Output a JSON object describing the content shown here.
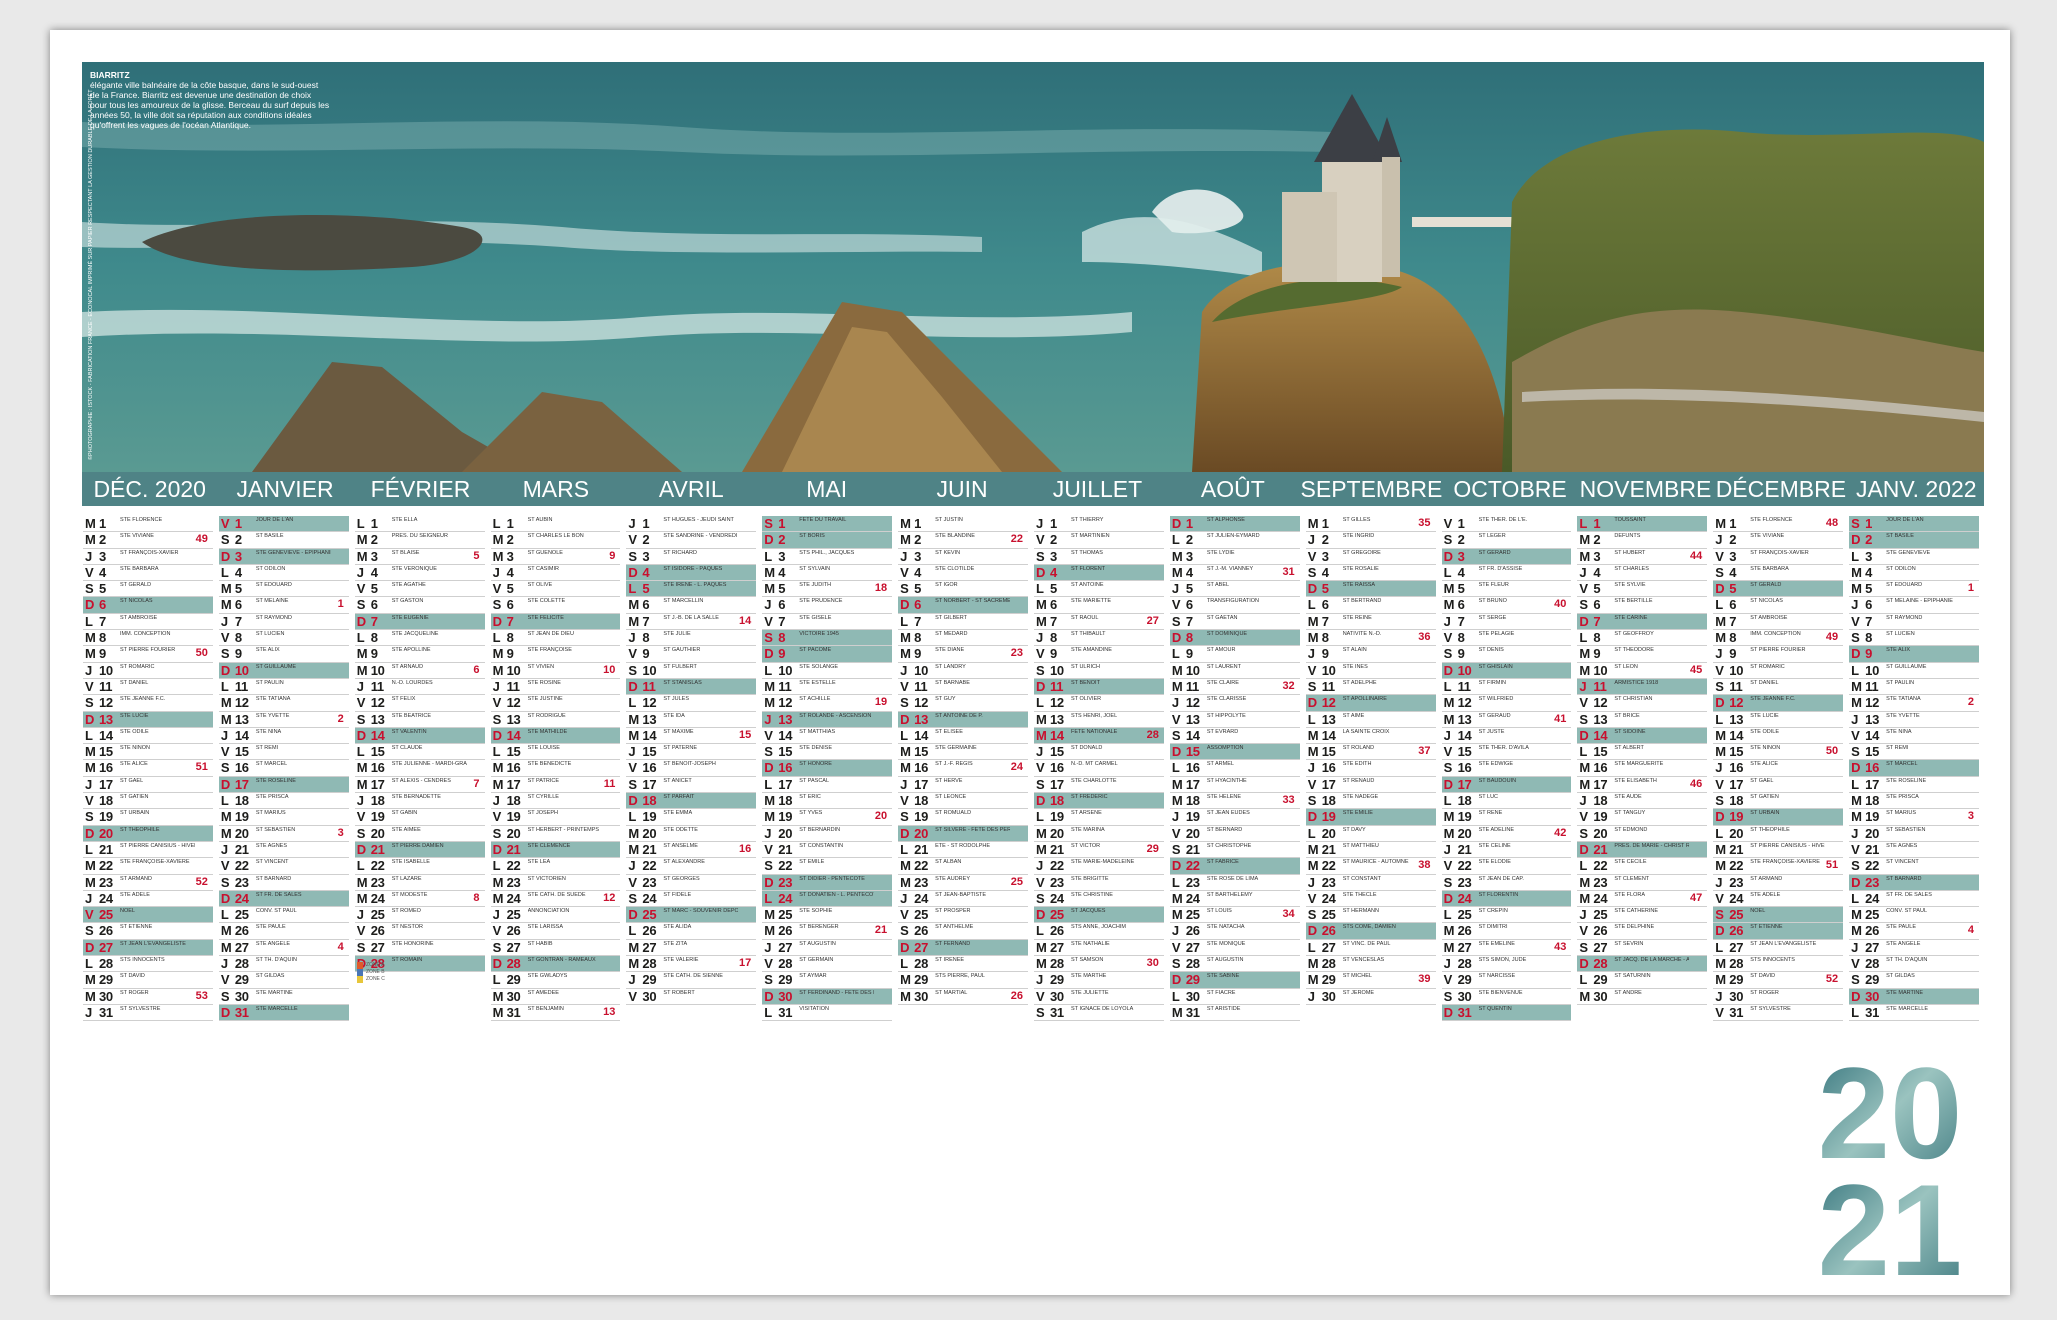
{
  "caption": {
    "title": "BIARRITZ",
    "text": "élégante ville balnéaire de la côte basque, dans le sud-ouest de la France. Biarritz est devenue une destination de choix pour tous les amoureux de la glisse. Berceau du surf depuis les années 50, la ville doit sa réputation aux conditions idéales qu'offrent les vagues de l'océan Atlantique."
  },
  "credit": "©PHOTOGRAPHIE : ISTOCK - FABRICATION FRANCE - ECONOCAL IMPRIMÉ SUR PAPIER RESPECTANT LA GESTION DURABLE DE LA FORÊT",
  "year": {
    "top": "20",
    "bottom": "21"
  },
  "colors": {
    "band": "#4f8386",
    "highlight": "#8fb9b4",
    "sunday": "#c8102e"
  },
  "months": [
    {
      "name": "DÉC. 2020",
      "start": 1,
      "days": 31
    },
    {
      "name": "JANVIER",
      "start": 4,
      "days": 31
    },
    {
      "name": "FÉVRIER",
      "start": 0,
      "days": 28
    },
    {
      "name": "MARS",
      "start": 0,
      "days": 31
    },
    {
      "name": "AVRIL",
      "start": 3,
      "days": 30
    },
    {
      "name": "MAI",
      "start": 5,
      "days": 31
    },
    {
      "name": "JUIN",
      "start": 1,
      "days": 30
    },
    {
      "name": "JUILLET",
      "start": 3,
      "days": 31
    },
    {
      "name": "AOÛT",
      "start": 6,
      "days": 31
    },
    {
      "name": "SEPTEMBRE",
      "start": 2,
      "days": 30
    },
    {
      "name": "OCTOBRE",
      "start": 4,
      "days": 31
    },
    {
      "name": "NOVEMBRE",
      "start": 0,
      "days": 30
    },
    {
      "name": "DÉCEMBRE",
      "start": 2,
      "days": 31
    },
    {
      "name": "JANV. 2022",
      "start": 5,
      "days": 31
    }
  ],
  "weekday_letters": [
    "L",
    "M",
    "M",
    "J",
    "V",
    "S",
    "D"
  ],
  "holidays": {
    "DÉC. 2020": [
      25
    ],
    "JANVIER": [
      1
    ],
    "AVRIL": [
      5
    ],
    "MAI": [
      1,
      8,
      13,
      24
    ],
    "JUILLET": [
      14
    ],
    "AOÛT": [
      15
    ],
    "NOVEMBRE": [
      1,
      11
    ],
    "DÉCEMBRE": [
      25
    ],
    "JANV. 2022": [
      1
    ]
  },
  "week_numbers": {
    "DÉC. 2020": [
      [
        2,
        49
      ],
      [
        9,
        50
      ],
      [
        16,
        51
      ],
      [
        23,
        52
      ],
      [
        30,
        53
      ]
    ],
    "JANVIER": [
      [
        6,
        1
      ],
      [
        13,
        2
      ],
      [
        20,
        3
      ],
      [
        27,
        4
      ]
    ],
    "FÉVRIER": [
      [
        3,
        5
      ],
      [
        10,
        6
      ],
      [
        17,
        7
      ],
      [
        24,
        8
      ]
    ],
    "MARS": [
      [
        3,
        9
      ],
      [
        10,
        10
      ],
      [
        17,
        11
      ],
      [
        24,
        12
      ],
      [
        31,
        13
      ]
    ],
    "AVRIL": [
      [
        7,
        14
      ],
      [
        14,
        15
      ],
      [
        21,
        16
      ],
      [
        28,
        17
      ]
    ],
    "MAI": [
      [
        5,
        18
      ],
      [
        12,
        19
      ],
      [
        19,
        20
      ],
      [
        26,
        21
      ]
    ],
    "JUIN": [
      [
        2,
        22
      ],
      [
        9,
        23
      ],
      [
        16,
        24
      ],
      [
        23,
        25
      ],
      [
        30,
        26
      ]
    ],
    "JUILLET": [
      [
        7,
        27
      ],
      [
        14,
        28
      ],
      [
        21,
        29
      ],
      [
        28,
        30
      ]
    ],
    "AOÛT": [
      [
        4,
        31
      ],
      [
        11,
        32
      ],
      [
        18,
        33
      ],
      [
        25,
        34
      ]
    ],
    "SEPTEMBRE": [
      [
        1,
        35
      ],
      [
        8,
        36
      ],
      [
        15,
        37
      ],
      [
        22,
        38
      ],
      [
        29,
        39
      ]
    ],
    "OCTOBRE": [
      [
        6,
        40
      ],
      [
        13,
        41
      ],
      [
        20,
        42
      ],
      [
        27,
        43
      ]
    ],
    "NOVEMBRE": [
      [
        3,
        44
      ],
      [
        10,
        45
      ],
      [
        17,
        46
      ],
      [
        24,
        47
      ]
    ],
    "DÉCEMBRE": [
      [
        1,
        48
      ],
      [
        8,
        49
      ],
      [
        15,
        50
      ],
      [
        22,
        51
      ],
      [
        29,
        52
      ]
    ],
    "JANV. 2022": [
      [
        5,
        1
      ],
      [
        12,
        2
      ],
      [
        19,
        3
      ],
      [
        26,
        4
      ]
    ]
  },
  "saints": {
    "DÉC. 2020": [
      "STE FLORENCE",
      "STE VIVIANE",
      "ST FRANÇOIS-XAVIER",
      "STE BARBARA",
      "ST GÉRALD",
      "ST NICOLAS",
      "ST AMBROISE",
      "IMM. CONCEPTION",
      "ST PIERRE FOURIER",
      "ST ROMARIC",
      "ST DANIEL",
      "STE JEANNE F.C.",
      "STE LUCIE",
      "STE ODILE",
      "STE NINON",
      "STE ALICE",
      "ST GAËL",
      "ST GATIEN",
      "ST URBAIN",
      "ST THÉOPHILE",
      "ST PIERRE CANISIUS - HIVER",
      "STE FRANÇOISE-XAVIÈRE",
      "ST ARMAND",
      "STE ADÈLE",
      "NOËL",
      "ST ÉTIENNE",
      "ST JEAN L'ÉVANGÉLISTE",
      "STS INNOCENTS",
      "ST DAVID",
      "ST ROGER",
      "ST SYLVESTRE"
    ],
    "JANVIER": [
      "JOUR DE L'AN",
      "ST BASILE",
      "STE GENEVIÈVE - ÉPIPHANIE",
      "ST ODILON",
      "ST ÉDOUARD",
      "ST MÉLAINE",
      "ST RAYMOND",
      "ST LUCIEN",
      "STE ALIX",
      "ST GUILLAUME",
      "ST PAULIN",
      "STE TATIANA",
      "STE YVETTE",
      "STE NINA",
      "ST RÉMI",
      "ST MARCEL",
      "STE ROSELINE",
      "STE PRISCA",
      "ST MARIUS",
      "ST SÉBASTIEN",
      "STE AGNÈS",
      "ST VINCENT",
      "ST BARNARD",
      "ST FR. DE SALES",
      "CONV. ST PAUL",
      "STE PAULE",
      "STE ANGÈLE",
      "ST TH. D'AQUIN",
      "ST GILDAS",
      "STE MARTINE",
      "STE MARCELLE"
    ],
    "FÉVRIER": [
      "STE ELLA",
      "PRÉS. DU SEIGNEUR",
      "ST BLAISE",
      "STE VÉRONIQUE",
      "STE AGATHE",
      "ST GASTON",
      "STE EUGÉNIE",
      "STE JACQUELINE",
      "STE APOLLINE",
      "ST ARNAUD",
      "N.-D. LOURDES",
      "ST FÉLIX",
      "STE BÉATRICE",
      "ST VALENTIN",
      "ST CLAUDE",
      "STE JULIENNE - MARDI-GRAS",
      "ST ALEXIS - CENDRES",
      "STE BERNADETTE",
      "ST GABIN",
      "STE AIMÉE",
      "ST PIERRE DAMIEN",
      "STE ISABELLE",
      "ST LAZARE",
      "ST MODESTE",
      "ST ROMÉO",
      "ST NESTOR",
      "STE HONORINE",
      "ST ROMAIN"
    ],
    "MARS": [
      "ST AUBIN",
      "ST CHARLES LE BON",
      "ST GUÉNOLÉ",
      "ST CASIMIR",
      "ST OLIVE",
      "STE COLETTE",
      "STE FÉLICITÉ",
      "ST JEAN DE DIEU",
      "STE FRANÇOISE",
      "ST VIVIEN",
      "STE ROSINE",
      "STE JUSTINE",
      "ST RODRIGUE",
      "STE MATHILDE",
      "STE LOUISE",
      "STE BÉNÉDICTE",
      "ST PATRICE",
      "ST CYRILLE",
      "ST JOSEPH",
      "ST HERBERT - PRINTEMPS",
      "STE CLÉMENCE",
      "STE LÉA",
      "ST VICTORIEN",
      "STE CATH. DE SUÈDE",
      "ANNONCIATION",
      "STE LARISSA",
      "ST HABIB",
      "ST GONTRAN - RAMEAUX",
      "STE GWLADYS",
      "ST AMÉDÉE",
      "ST BENJAMIN"
    ],
    "AVRIL": [
      "ST HUGUES - JEUDI SAINT",
      "STE SANDRINE - VENDREDI SAINT",
      "ST RICHARD",
      "ST ISIDORE - PÂQUES",
      "STE IRÈNE - L. PÂQUES",
      "ST MARCELLIN",
      "ST J.-B. DE LA SALLE",
      "STE JULIE",
      "ST GAUTHIER",
      "ST FULBERT",
      "ST STANISLAS",
      "ST JULES",
      "STE IDA",
      "ST MAXIME",
      "ST PATERNE",
      "ST BENOÎT-JOSEPH",
      "ST ANICET",
      "ST PARFAIT",
      "STE EMMA",
      "STE ODETTE",
      "ST ANSELME",
      "ST ALEXANDRE",
      "ST GEORGES",
      "ST FIDÈLE",
      "ST MARC - SOUVENIR DÉPORTÉS",
      "STE ALIDA",
      "STE ZITA",
      "STE VALÉRIE",
      "STE CATH. DE SIENNE",
      "ST ROBERT"
    ],
    "MAI": [
      "FÊTE DU TRAVAIL",
      "ST BORIS",
      "STS PHIL., JACQUES",
      "ST SYLVAIN",
      "STE JUDITH",
      "STE PRUDENCE",
      "STE GISÈLE",
      "VICTOIRE 1945",
      "ST PACÔME",
      "STE SOLANGE",
      "STE ESTELLE",
      "ST ACHILLE",
      "ST ROLANDE - ASCENSION",
      "ST MATTHIAS",
      "STE DENISE",
      "ST HONORÉ",
      "ST PASCAL",
      "ST ÉRIC",
      "ST YVES",
      "ST BERNARDIN",
      "ST CONSTANTIN",
      "ST ÉMILE",
      "ST DIDIER - PENTECÔTE",
      "ST DONATIEN - L. PENTECÔTE",
      "STE SOPHIE",
      "ST BÉRENGER",
      "ST AUGUSTIN",
      "ST GERMAIN",
      "ST AYMAR",
      "ST FERDINAND - FÊTE DES MÈRES",
      "VISITATION"
    ],
    "JUIN": [
      "ST JUSTIN",
      "STE BLANDINE",
      "ST KÉVIN",
      "STE CLOTILDE",
      "ST IGOR",
      "ST NORBERT - ST SACREMENT",
      "ST GILBERT",
      "ST MÉDARD",
      "STE DIANE",
      "ST LANDRY",
      "ST BARNABÉ",
      "ST GUY",
      "ST ANTOINE DE P.",
      "ST ÉLISÉE",
      "STE GERMAINE",
      "ST J.-F. RÉGIS",
      "ST HERVÉ",
      "ST LÉONCE",
      "ST ROMUALD",
      "ST SILVÈRE - FÊTE DES PÈRES",
      "ÉTÉ - ST RODOLPHE",
      "ST ALBAN",
      "STE AUDREY",
      "ST JEAN-BAPTISTE",
      "ST PROSPER",
      "ST ANTHELME",
      "ST FERNAND",
      "ST IRÉNÉE",
      "STS PIERRE, PAUL",
      "ST MARTIAL"
    ],
    "JUILLET": [
      "ST THIERRY",
      "ST MARTINIEN",
      "ST THOMAS",
      "ST FLORENT",
      "ST ANTOINE",
      "STE MARIETTE",
      "ST RAOUL",
      "ST THIBAULT",
      "STE AMANDINE",
      "ST ULRICH",
      "ST BENOÎT",
      "ST OLIVIER",
      "STS HENRI, JOËL",
      "FÊTE NATIONALE",
      "ST DONALD",
      "N.-D. MT CARMEL",
      "STE CHARLOTTE",
      "ST FRÉDÉRIC",
      "ST ARSÈNE",
      "STE MARINA",
      "ST VICTOR",
      "STE MARIE-MADELEINE",
      "STE BRIGITTE",
      "STE CHRISTINE",
      "ST JACQUES",
      "STS ANNE, JOACHIM",
      "STE NATHALIE",
      "ST SAMSON",
      "STE MARTHE",
      "STE JULIETTE",
      "ST IGNACE DE LOYOLA"
    ],
    "AOÛT": [
      "ST ALPHONSE",
      "ST JULIEN-EYMARD",
      "STE LYDIE",
      "ST J.-M. VIANNEY",
      "ST ABEL",
      "TRANSFIGURATION",
      "ST GAÉTAN",
      "ST DOMINIQUE",
      "ST AMOUR",
      "ST LAURENT",
      "STE CLAIRE",
      "STE CLARISSE",
      "ST HIPPOLYTE",
      "ST ÉVRARD",
      "ASSOMPTION",
      "ST ARMEL",
      "ST HYACINTHE",
      "STE HÉLÈNE",
      "ST JEAN EUDES",
      "ST BERNARD",
      "ST CHRISTOPHE",
      "ST FABRICE",
      "STE ROSE DE LIMA",
      "ST BARTHÉLÉMY",
      "ST LOUIS",
      "STE NATACHA",
      "STE MONIQUE",
      "ST AUGUSTIN",
      "STE SABINE",
      "ST FIACRE",
      "ST ARISTIDE"
    ],
    "SEPTEMBRE": [
      "ST GILLES",
      "STE INGRID",
      "ST GRÉGOIRE",
      "STE ROSALIE",
      "STE RAÏSSA",
      "ST BERTRAND",
      "STE REINE",
      "NATIVITÉ N.-D.",
      "ST ALAIN",
      "STE INÈS",
      "ST ADELPHE",
      "ST APOLLINAIRE",
      "ST AIMÉ",
      "LA SAINTE CROIX",
      "ST ROLAND",
      "STE ÉDITH",
      "ST RENAUD",
      "STE NADÈGE",
      "STE ÉMILIE",
      "ST DAVY",
      "ST MATTHIEU",
      "ST MAURICE - AUTOMNE",
      "ST CONSTANT",
      "STE THÈCLE",
      "ST HERMANN",
      "STS CÔME, DAMIEN",
      "ST VINC. DE PAUL",
      "ST VENCESLAS",
      "ST MICHEL",
      "ST JÉRÔME"
    ],
    "OCTOBRE": [
      "STE THÉR. DE L'E.",
      "ST LÉGER",
      "ST GÉRARD",
      "ST FR. D'ASSISE",
      "STE FLEUR",
      "ST BRUNO",
      "ST SERGE",
      "STE PÉLAGIE",
      "ST DENIS",
      "ST GHISLAIN",
      "ST FIRMIN",
      "ST WILFRIED",
      "ST GÉRAUD",
      "ST JUSTE",
      "STE THÉR. D'AVILA",
      "STE EDWIGE",
      "ST BAUDOUIN",
      "ST LUC",
      "ST RENÉ",
      "STE ADELINE",
      "STE CÉLINE",
      "STE ÉLODIE",
      "ST JEAN DE CAP.",
      "ST FLORENTIN",
      "ST CRÉPIN",
      "ST DIMITRI",
      "STE ÉMELINE",
      "STS SIMON, JUDE",
      "ST NARCISSE",
      "STE BIENVENUE",
      "ST QUENTIN"
    ],
    "NOVEMBRE": [
      "TOUSSAINT",
      "DÉFUNTS",
      "ST HUBERT",
      "ST CHARLES",
      "STE SYLVIE",
      "STE BERTILLE",
      "STE CARINE",
      "ST GEOFFROY",
      "ST THÉODORE",
      "ST LÉON",
      "ARMISTICE 1918",
      "ST CHRISTIAN",
      "ST BRICE",
      "ST SIDOINE",
      "ST ALBERT",
      "STE MARGUERITE",
      "STE ÉLISABETH",
      "STE AUDE",
      "ST TANGUY",
      "ST EDMOND",
      "PRÉS. DE MARIE - CHRIST ROI",
      "STE CÉCILE",
      "ST CLÉMENT",
      "STE FLORA",
      "STE CATHERINE",
      "STE DELPHINE",
      "ST SÉVRIN",
      "ST JACQ. DE LA MARCHE - AVENT",
      "ST SATURNIN",
      "ST ANDRÉ"
    ],
    "DÉCEMBRE": [
      "STE FLORENCE",
      "STE VIVIANE",
      "ST FRANÇOIS-XAVIER",
      "STE BARBARA",
      "ST GÉRALD",
      "ST NICOLAS",
      "ST AMBROISE",
      "IMM. CONCEPTION",
      "ST PIERRE FOURIER",
      "ST ROMARIC",
      "ST DANIEL",
      "STE JEANNE F.C.",
      "STE LUCIE",
      "STE ODILE",
      "STE NINON",
      "STE ALICE",
      "ST GAËL",
      "ST GATIEN",
      "ST URBAIN",
      "ST THÉOPHILE",
      "ST PIERRE CANISIUS - HIVER",
      "STE FRANÇOISE-XAVIÈRE",
      "ST ARMAND",
      "STE ADÈLE",
      "NOËL",
      "ST ÉTIENNE",
      "ST JEAN L'ÉVANGÉLISTE",
      "STS INNOCENTS",
      "ST DAVID",
      "ST ROGER",
      "ST SYLVESTRE"
    ],
    "JANV. 2022": [
      "JOUR DE L'AN",
      "ST BASILE",
      "STE GENEVIÈVE",
      "ST ODILON",
      "ST ÉDOUARD",
      "ST MÉLAINE - ÉPIPHANIE",
      "ST RAYMOND",
      "ST LUCIEN",
      "STE ALIX",
      "ST GUILLAUME",
      "ST PAULIN",
      "STE TATIANA",
      "STE YVETTE",
      "STE NINA",
      "ST RÉMI",
      "ST MARCEL",
      "STE ROSELINE",
      "STE PRISCA",
      "ST MARIUS",
      "ST SÉBASTIEN",
      "STE AGNÈS",
      "ST VINCENT",
      "ST BARNARD",
      "ST FR. DE SALES",
      "CONV. ST PAUL",
      "STE PAULE",
      "STE ANGÈLE",
      "ST TH. D'AQUIN",
      "ST GILDAS",
      "STE MARTINE",
      "STE MARCELLE"
    ]
  }
}
